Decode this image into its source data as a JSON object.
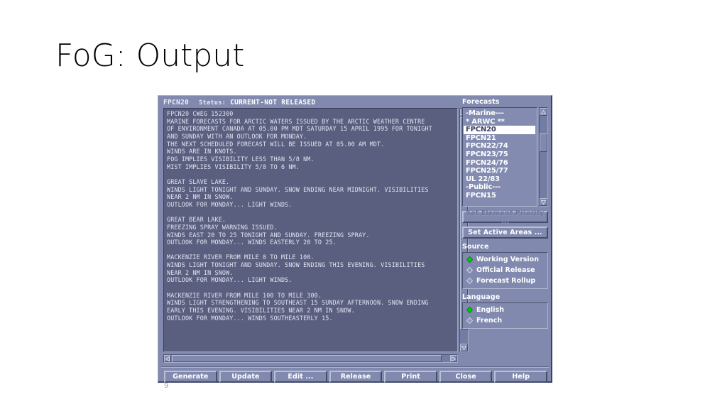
{
  "slide": {
    "title": "FoG: Output"
  },
  "window": {
    "status_bar": {
      "product_id": "FPCN20",
      "status_label": "Status:",
      "status_value": "CURRENT-NOT RELEASED"
    },
    "text_area": {
      "content": "FPCN20 CWEG 152300\nMARINE FORECASTS FOR ARCTIC WATERS ISSUED BY THE ARCTIC WEATHER CENTRE\nOF ENVIRONMENT CANADA AT 05.00 PM MDT SATURDAY 15 APRIL 1995 FOR TONIGHT\nAND SUNDAY WITH AN OUTLOOK FOR MONDAY.\nTHE NEXT SCHEDULED FORECAST WILL BE ISSUED AT 05.00 AM MDT.\nWINDS ARE IN KNOTS.\nFOG IMPLIES VISIBILITY LESS THAN 5/8 NM.\nMIST IMPLIES VISIBILITY 5/8 TO 6 NM.\n\nGREAT SLAVE LAKE.\nWINDS LIGHT TONIGHT AND SUNDAY. SNOW ENDING NEAR MIDNIGHT. VISIBILITIES\nNEAR 2 NM IN SNOW.\nOUTLOOK FOR MONDAY... LIGHT WINDS.\n\nGREAT BEAR LAKE.\nFREEZING SPRAY WARNING ISSUED.\nWINDS EAST 20 TO 25 TONIGHT AND SUNDAY. FREEZING SPRAY.\nOUTLOOK FOR MONDAY... WINDS EASTERLY 20 TO 25.\n\nMACKENZIE RIVER FROM MILE 0 TO MILE 100.\nWINDS LIGHT TONIGHT AND SUNDAY. SNOW ENDING THIS EVENING. VISIBILITIES\nNEAR 2 NM IN SNOW.\nOUTLOOK FOR MONDAY... LIGHT WINDS.\n\nMACKENZIE RIVER FROM MILE 100 TO MILE 300.\nWINDS LIGHT STRENGTHENING TO SOUTHEAST 15 SUNDAY AFTERNOON. SNOW ENDING\nEARLY THIS EVENING. VISIBILITIES NEAR 2 NM IN SNOW.\nOUTLOOK FOR MONDAY... WINDS SOUTHEASTERLY 15."
    },
    "forecasts": {
      "label": "Forecasts",
      "items": [
        {
          "label": "-Marine---",
          "selected": false
        },
        {
          "label": "* ARWC **",
          "selected": false
        },
        {
          "label": "FPCN20",
          "selected": true
        },
        {
          "label": "FPCN21",
          "selected": false
        },
        {
          "label": "FPCN22/74",
          "selected": false
        },
        {
          "label": "FPCN23/75",
          "selected": false
        },
        {
          "label": "FPCN24/76",
          "selected": false
        },
        {
          "label": "FPCN25/77",
          "selected": false
        },
        {
          "label": "UL 22/83",
          "selected": false
        },
        {
          "label": "-Public---",
          "selected": false
        },
        {
          "label": "FPCN15",
          "selected": false
        }
      ]
    },
    "side_buttons": {
      "set_element_priority": "Set Element Priority ...",
      "set_active_areas": "Set Active Areas ..."
    },
    "source": {
      "label": "Source",
      "options": [
        {
          "label": "Working Version",
          "selected": true
        },
        {
          "label": "Official Release",
          "selected": false
        },
        {
          "label": "Forecast Rollup",
          "selected": false
        }
      ]
    },
    "language": {
      "label": "Language",
      "options": [
        {
          "label": "English",
          "selected": true
        },
        {
          "label": "French",
          "selected": false
        }
      ]
    },
    "action_buttons": [
      "Generate",
      "Update",
      "Edit ...",
      "Release",
      "Print",
      "Close",
      "Help"
    ]
  },
  "colors": {
    "window_face": "#818aae",
    "text_area_bg": "#5b5f7f",
    "selected_item_bg": "#ffffff",
    "radio_selected": "#00d000",
    "text_fg": "#e2e4f2"
  },
  "artifact": {
    "glyph": "9"
  }
}
